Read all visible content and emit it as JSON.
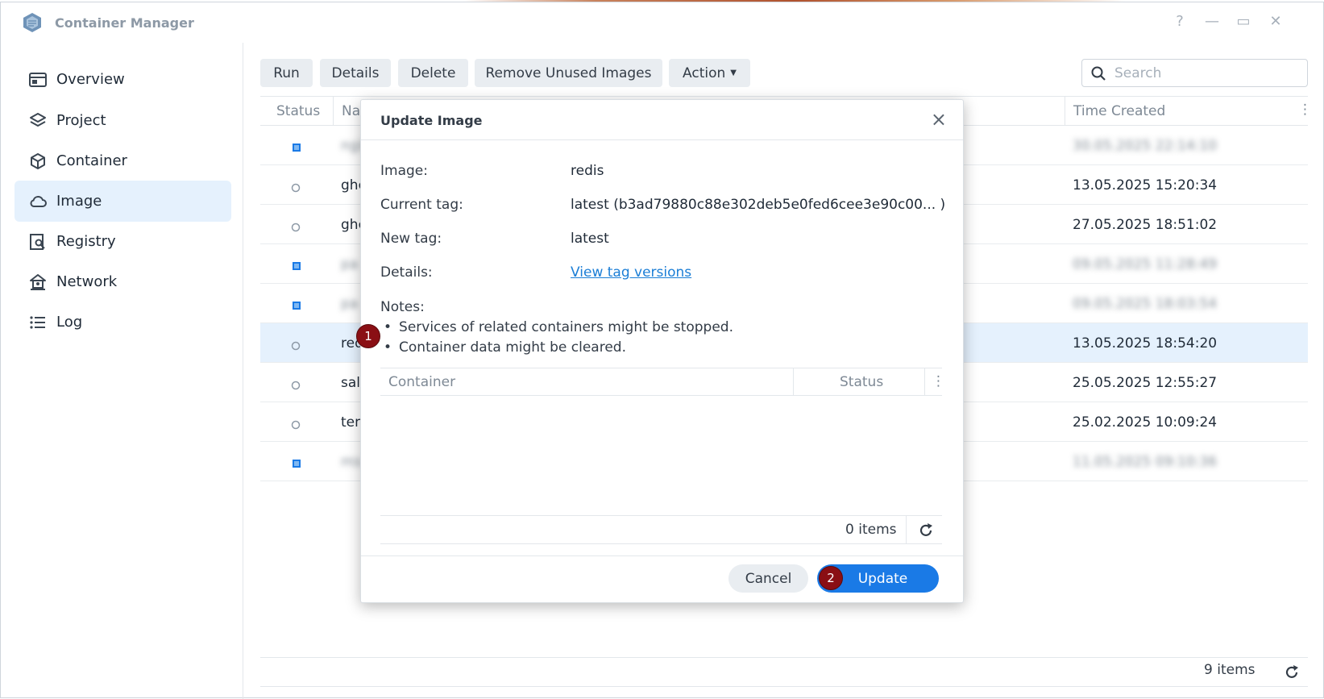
{
  "window": {
    "title": "Container Manager",
    "controls": {
      "help": "?",
      "minimize": "—",
      "maximize": "▭",
      "close": "✕"
    }
  },
  "sidebar": {
    "items": [
      {
        "label": "Overview",
        "icon": "overview-icon",
        "active": false
      },
      {
        "label": "Project",
        "icon": "layers-icon",
        "active": false
      },
      {
        "label": "Container",
        "icon": "cube-icon",
        "active": false
      },
      {
        "label": "Image",
        "icon": "cloud-icon",
        "active": true
      },
      {
        "label": "Registry",
        "icon": "registry-icon",
        "active": false
      },
      {
        "label": "Network",
        "icon": "network-icon",
        "active": false
      },
      {
        "label": "Log",
        "icon": "list-icon",
        "active": false
      }
    ]
  },
  "toolbar": {
    "run": "Run",
    "details": "Details",
    "delete": "Delete",
    "remove_unused": "Remove Unused Images",
    "action": "Action",
    "search_placeholder": "Search"
  },
  "table": {
    "columns": {
      "status": "Status",
      "name": "Na",
      "time_created": "Time Created"
    },
    "rows": [
      {
        "status": "active",
        "name": "nginx",
        "time": "30.05.2025 22:14:10",
        "blurred": true,
        "selected": false
      },
      {
        "status": "inactive",
        "name": "ghc",
        "time": "13.05.2025 15:20:34",
        "blurred": false,
        "selected": false
      },
      {
        "status": "inactive",
        "name": "ghc",
        "time": "27.05.2025 18:51:02",
        "blurred": false,
        "selected": false
      },
      {
        "status": "active",
        "name": "pa",
        "time": "09.05.2025 11:28:49",
        "blurred": true,
        "selected": false
      },
      {
        "status": "active",
        "name": "pa",
        "time": "09.05.2025 18:03:54",
        "blurred": true,
        "selected": false
      },
      {
        "status": "inactive",
        "name": "red",
        "time": "13.05.2025 18:54:20",
        "blurred": false,
        "selected": true
      },
      {
        "status": "inactive",
        "name": "sal",
        "time": "25.05.2025 12:55:27",
        "blurred": false,
        "selected": false
      },
      {
        "status": "inactive",
        "name": "ten",
        "time": "25.02.2025 10:09:24",
        "blurred": false,
        "selected": false
      },
      {
        "status": "active",
        "name": "ms",
        "time": "11.05.2025 09:10:36",
        "blurred": true,
        "selected": false
      }
    ],
    "footer_count": "9 items"
  },
  "dialog": {
    "title": "Update Image",
    "fields": [
      {
        "label": "Image:",
        "value": "redis"
      },
      {
        "label": "Current tag:",
        "value": "latest (b3ad79880c88e302deb5e0fed6cee3e90c00... )"
      },
      {
        "label": "New tag:",
        "value": "latest"
      },
      {
        "label": "Details:",
        "value": "View tag versions",
        "link": true
      }
    ],
    "notes_title": "Notes:",
    "notes": [
      "Services of related containers might be stopped.",
      "Container data might be cleared."
    ],
    "inner_table": {
      "col_container": "Container",
      "col_status": "Status",
      "footer_count": "0 items"
    },
    "cancel": "Cancel",
    "update": "Update"
  },
  "markers": {
    "m1": "1",
    "m2": "2"
  },
  "colors": {
    "accent": "#1a7ae6",
    "active_nav": "#e5f1fd",
    "marker": "#8a0f14"
  }
}
